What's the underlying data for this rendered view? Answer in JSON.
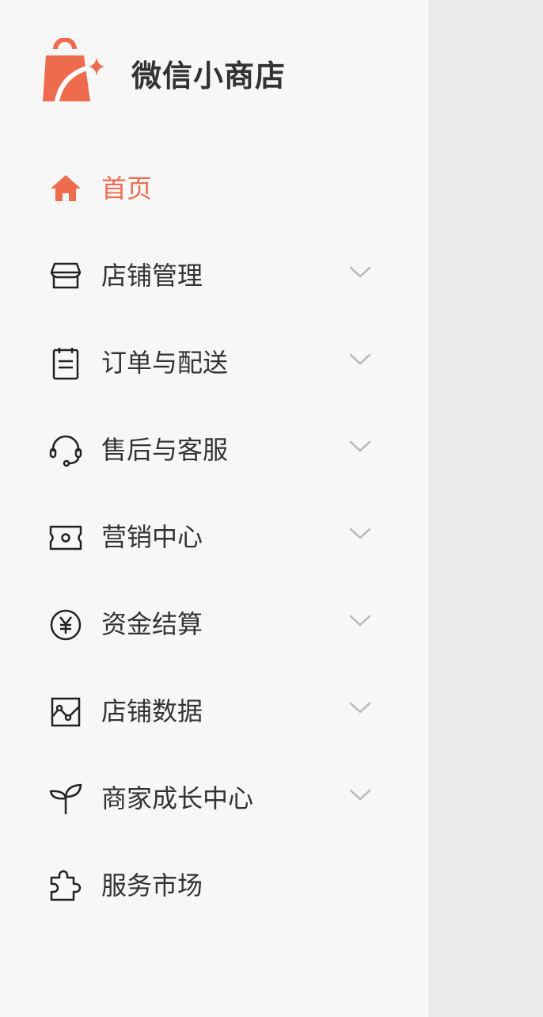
{
  "app": {
    "name": "微信小商店",
    "logo_icon": "shopping-bag-sparkle-icon",
    "accent_color": "#ee6c4d"
  },
  "nav": {
    "items": [
      {
        "label": "首页",
        "icon": "home-icon",
        "active": true,
        "expandable": false
      },
      {
        "label": "店铺管理",
        "icon": "store-icon",
        "active": false,
        "expandable": true
      },
      {
        "label": "订单与配送",
        "icon": "clipboard-icon",
        "active": false,
        "expandable": true
      },
      {
        "label": "售后与客服",
        "icon": "headset-icon",
        "active": false,
        "expandable": true
      },
      {
        "label": "营销中心",
        "icon": "ticket-icon",
        "active": false,
        "expandable": true
      },
      {
        "label": "资金结算",
        "icon": "yuan-coin-icon",
        "active": false,
        "expandable": true
      },
      {
        "label": "店铺数据",
        "icon": "line-chart-icon",
        "active": false,
        "expandable": true
      },
      {
        "label": "商家成长中心",
        "icon": "sprout-icon",
        "active": false,
        "expandable": true
      },
      {
        "label": "服务市场",
        "icon": "puzzle-icon",
        "active": false,
        "expandable": false
      }
    ]
  }
}
